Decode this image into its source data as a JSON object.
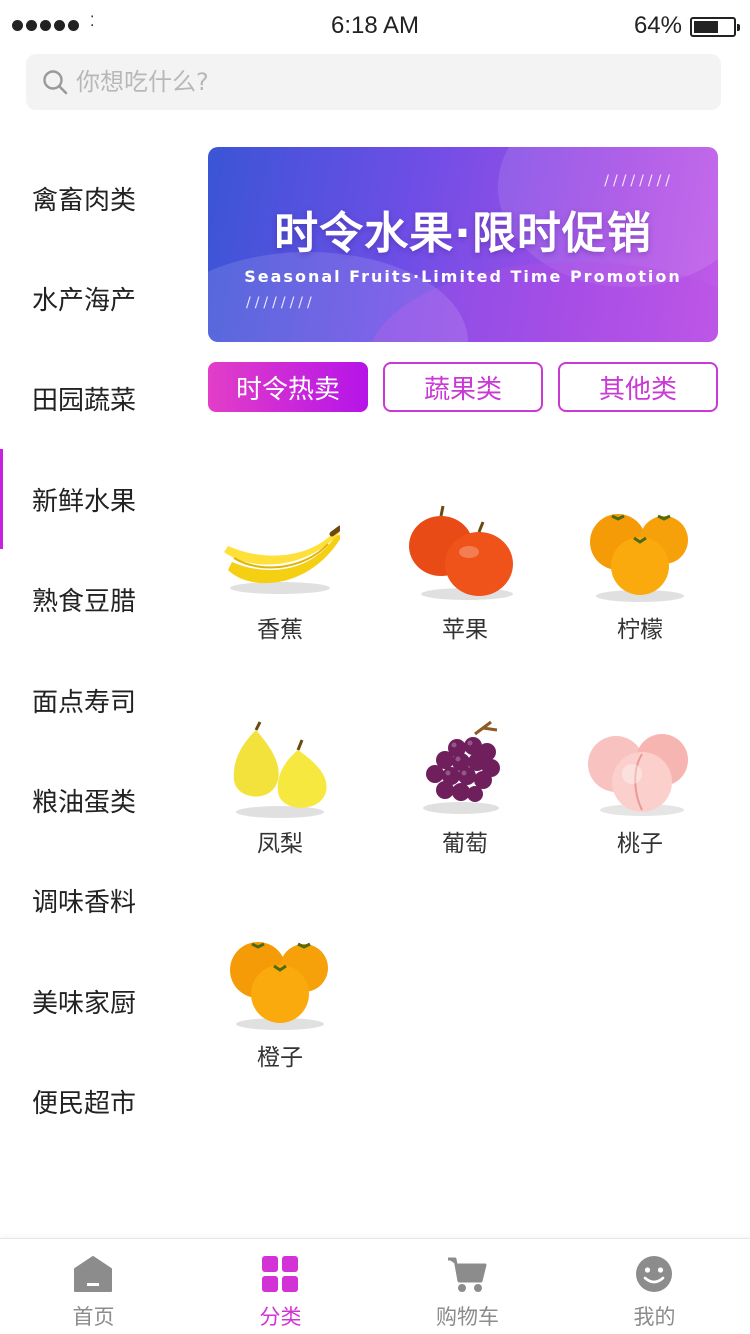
{
  "status_bar": {
    "time": "6:18 AM",
    "battery": "64%",
    "battery_level": 0.64,
    "signal_icon": "signal-dots-icon",
    "wifi_icon": "wifi-icon"
  },
  "search": {
    "placeholder": "你想吃什么?",
    "icon": "search-icon"
  },
  "sidebar": {
    "active_index": 3,
    "items": [
      {
        "label": "禽畜肉类"
      },
      {
        "label": "水产海产"
      },
      {
        "label": "田园蔬菜"
      },
      {
        "label": "新鲜水果"
      },
      {
        "label": "熟食豆腊"
      },
      {
        "label": "面点寿司"
      },
      {
        "label": "粮油蛋类"
      },
      {
        "label": "调味香料"
      },
      {
        "label": "美味家厨"
      },
      {
        "label": "便民超市"
      }
    ]
  },
  "banner": {
    "title": "时令水果·限时促销",
    "subtitle": "Seasonal Fruits·Limited Time Promotion",
    "slashes": "////////",
    "gradient": [
      "#3a55d6",
      "#c25ae8"
    ]
  },
  "tabs": [
    {
      "label": "时令热卖",
      "active": true
    },
    {
      "label": "蔬果类",
      "active": false
    },
    {
      "label": "其他类",
      "active": false
    }
  ],
  "products": [
    {
      "name": "香蕉",
      "icon": "banana-icon"
    },
    {
      "name": "苹果",
      "icon": "apple-icon"
    },
    {
      "name": "柠檬",
      "icon": "lemon-icon"
    },
    {
      "name": "凤梨",
      "icon": "pear-icon"
    },
    {
      "name": "葡萄",
      "icon": "grape-icon"
    },
    {
      "name": "桃子",
      "icon": "peach-icon"
    },
    {
      "name": "橙子",
      "icon": "orange-icon"
    }
  ],
  "tabbar": [
    {
      "label": "首页",
      "icon": "home-icon",
      "active": false
    },
    {
      "label": "分类",
      "icon": "category-grid-icon",
      "active": true
    },
    {
      "label": "购物车",
      "icon": "cart-icon",
      "active": false
    },
    {
      "label": "我的",
      "icon": "smiley-icon",
      "active": false
    }
  ],
  "colors": {
    "accent": "#d333d6",
    "accent_gradient": [
      "#e23ec8",
      "#b514e8"
    ],
    "inactive": "#8c8c8c"
  }
}
